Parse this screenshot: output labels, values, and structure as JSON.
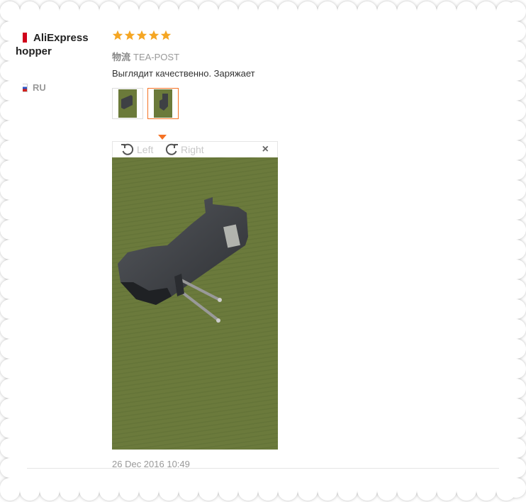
{
  "reviewer": {
    "name_line1": "AliExpress",
    "name_line2": "hopper",
    "country": "RU",
    "brand_color": "#d0021b"
  },
  "review": {
    "rating": 5,
    "star_color": "#f5a623",
    "logistics_label": "物流",
    "logistics_value": "TEA-POST",
    "feedback": "Выглядит качественно. Заряжает",
    "date": "26 Dec 2016 10:49"
  },
  "viewer": {
    "rotate_left_label": "Left",
    "rotate_right_label": "Right",
    "close_label": "×",
    "active_thumb_index": 1,
    "thumb_count": 2
  },
  "colors": {
    "active_border": "#f57224",
    "carpet": "#6b7a3a"
  }
}
